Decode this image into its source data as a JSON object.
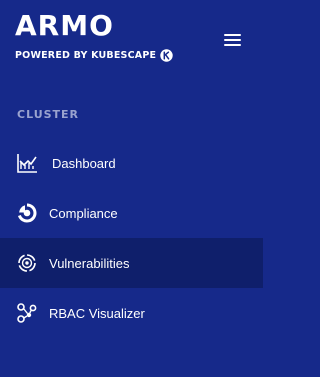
{
  "brand": {
    "logo_text": "ARMO",
    "tagline": "POWERED BY KUBESCAPE"
  },
  "menu": {
    "icon": "hamburger-menu-icon"
  },
  "section": {
    "title": "CLUSTER"
  },
  "nav": {
    "items": [
      {
        "label": "Dashboard",
        "icon": "dashboard-chart-icon",
        "active": false
      },
      {
        "label": "Compliance",
        "icon": "compliance-pie-icon",
        "active": false
      },
      {
        "label": "Vulnerabilities",
        "icon": "vulnerabilities-target-icon",
        "active": true
      },
      {
        "label": "RBAC Visualizer",
        "icon": "rbac-graph-icon",
        "active": false
      }
    ]
  },
  "colors": {
    "sidebar_bg": "#16298a",
    "active_bg": "#0f1f6b",
    "section_title": "#9aa3cf",
    "text": "#ffffff"
  }
}
